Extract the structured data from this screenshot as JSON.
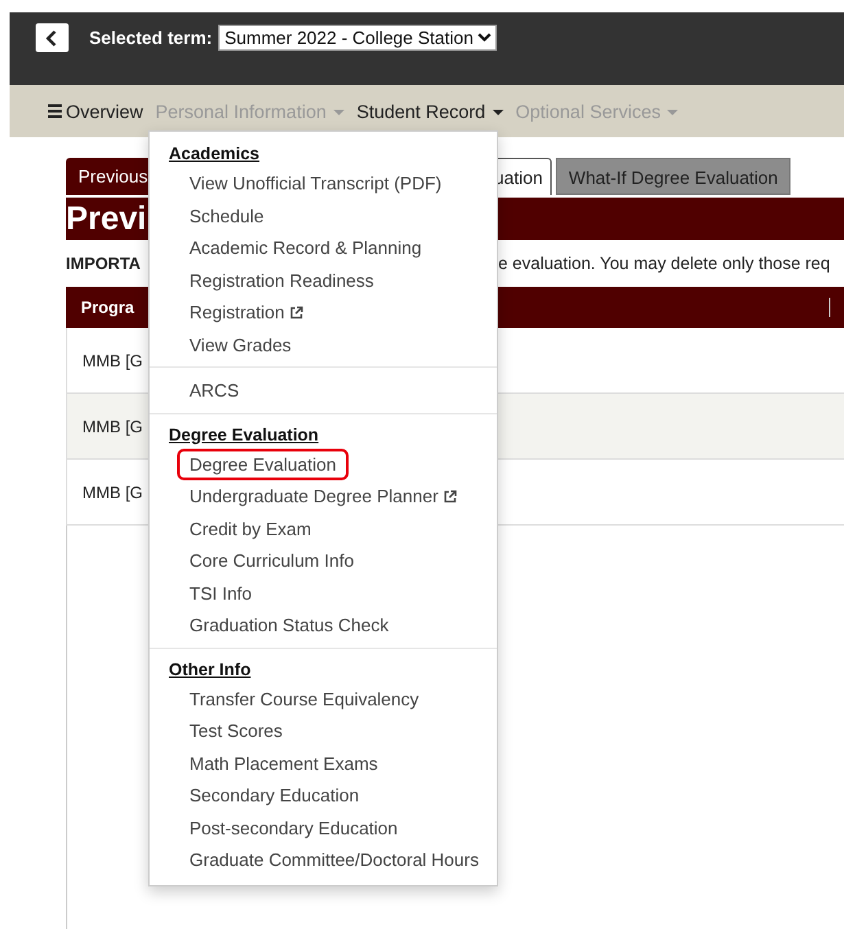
{
  "header": {
    "term_label": "Selected term:",
    "term_value": "Summer 2022 - College Station"
  },
  "nav": [
    {
      "label": "Overview",
      "kind": "menu",
      "active": true,
      "dropdown": false
    },
    {
      "label": "Personal Information",
      "kind": "plain",
      "active": false,
      "dropdown": true
    },
    {
      "label": "Student Record",
      "kind": "plain",
      "active": true,
      "dropdown": true
    },
    {
      "label": "Optional Services",
      "kind": "plain",
      "active": false,
      "dropdown": true
    }
  ],
  "page": {
    "tabs_left": [
      {
        "label": "Previous",
        "selected": false
      }
    ],
    "tabs_right": [
      {
        "label": "uation",
        "selected": true
      },
      {
        "label": "What-If Degree Evaluation",
        "selected": false
      }
    ],
    "heading": "Previ",
    "notice_left": "IMPORTA",
    "notice_right": "e evaluation. You may delete only those req",
    "table": {
      "column_1": "Progra",
      "rows": [
        {
          "cell": "MMB [G",
          "shaded": false
        },
        {
          "cell": "MMB [G",
          "shaded": true
        },
        {
          "cell": "MMB [G",
          "shaded": false
        }
      ]
    }
  },
  "menu": {
    "sections": [
      {
        "heading": "Academics",
        "items": [
          {
            "label": "View Unofficial Transcript (PDF)",
            "external": false,
            "selected": false
          },
          {
            "label": "Schedule",
            "external": false,
            "selected": false
          },
          {
            "label": "Academic Record & Planning",
            "external": false,
            "selected": false
          },
          {
            "label": "Registration Readiness",
            "external": false,
            "selected": false
          },
          {
            "label": "Registration",
            "external": true,
            "selected": false
          },
          {
            "label": "View Grades",
            "external": false,
            "selected": false
          }
        ]
      },
      {
        "items": [
          {
            "label": "ARCS",
            "external": false,
            "selected": false
          }
        ]
      },
      {
        "heading": "Degree Evaluation",
        "items": [
          {
            "label": "Degree Evaluation",
            "external": false,
            "selected": true
          },
          {
            "label": "Undergraduate Degree Planner",
            "external": true,
            "selected": false
          },
          {
            "label": "Credit by Exam",
            "external": false,
            "selected": false
          },
          {
            "label": "Core Curriculum Info",
            "external": false,
            "selected": false
          },
          {
            "label": "TSI Info",
            "external": false,
            "selected": false
          },
          {
            "label": "Graduation Status Check",
            "external": false,
            "selected": false
          }
        ]
      },
      {
        "heading": "Other Info",
        "items": [
          {
            "label": "Transfer Course Equivalency",
            "external": false,
            "selected": false
          },
          {
            "label": "Test Scores",
            "external": false,
            "selected": false
          },
          {
            "label": "Math Placement Exams",
            "external": false,
            "selected": false
          },
          {
            "label": "Secondary Education",
            "external": false,
            "selected": false
          },
          {
            "label": "Post-secondary Education",
            "external": false,
            "selected": false
          },
          {
            "label": "Graduate Committee/Doctoral Hours",
            "external": false,
            "selected": false
          }
        ]
      }
    ]
  }
}
